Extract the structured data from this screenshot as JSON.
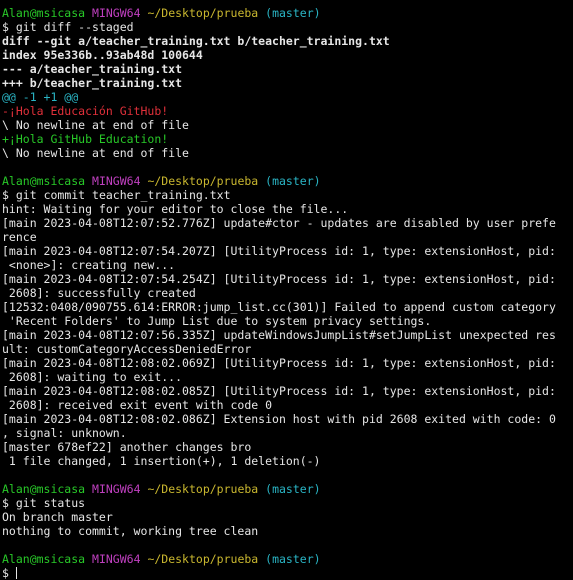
{
  "prompt": {
    "user_host": "Alan@msicasa",
    "shell": "MINGW64",
    "path": "~/Desktop/prueba",
    "branch": "(master)",
    "symbol": "$"
  },
  "block1": {
    "command": "git diff --staged",
    "diff_header": "diff --git a/teacher_training.txt b/teacher_training.txt",
    "index": "index 95e336b..93ab48d 100644",
    "minus_file": "--- a/teacher_training.txt",
    "plus_file": "+++ b/teacher_training.txt",
    "hunk": "@@ -1 +1 @@",
    "removed": "-¡Hola Educación GitHub!",
    "no_newline_1": "\\ No newline at end of file",
    "added": "+¡Hola GitHub Education!",
    "no_newline_2": "\\ No newline at end of file"
  },
  "block2": {
    "command": "git commit teacher_training.txt",
    "output": [
      "hint: Waiting for your editor to close the file...",
      "[main 2023-04-08T12:07:52.776Z] update#ctor - updates are disabled by user prefe",
      "rence",
      "[main 2023-04-08T12:07:54.207Z] [UtilityProcess id: 1, type: extensionHost, pid:",
      " <none>]: creating new...",
      "[main 2023-04-08T12:07:54.254Z] [UtilityProcess id: 1, type: extensionHost, pid:",
      " 2608]: successfully created",
      "[12532:0408/090755.614:ERROR:jump_list.cc(301)] Failed to append custom category",
      " 'Recent Folders' to Jump List due to system privacy settings.",
      "[main 2023-04-08T12:07:56.335Z] updateWindowsJumpList#setJumpList unexpected res",
      "ult: customCategoryAccessDeniedError",
      "[main 2023-04-08T12:08:02.069Z] [UtilityProcess id: 1, type: extensionHost, pid:",
      " 2608]: waiting to exit...",
      "[main 2023-04-08T12:08:02.085Z] [UtilityProcess id: 1, type: extensionHost, pid:",
      " 2608]: received exit event with code 0",
      "[main 2023-04-08T12:08:02.086Z] Extension host with pid 2608 exited with code: 0",
      ", signal: unknown.",
      "[master 678ef22] another changes bro",
      " 1 file changed, 1 insertion(+), 1 deletion(-)"
    ]
  },
  "block3": {
    "command": "git status",
    "output": [
      "On branch master",
      "nothing to commit, working tree clean"
    ]
  },
  "colors": {
    "background": "#000000",
    "foreground": "#e6e6e6",
    "user_host": "#28c828",
    "shell": "#c040c0",
    "path": "#c9b72f",
    "branch": "#2ab5c5",
    "removed": "#e0303a",
    "added": "#28c828",
    "hunk": "#2ab5c5"
  }
}
